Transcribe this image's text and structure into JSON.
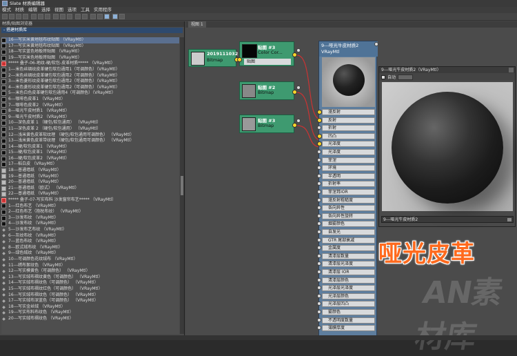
{
  "window": {
    "title": "Slate 材质编辑器"
  },
  "menu": [
    "模式",
    "材质",
    "编辑",
    "选择",
    "视图",
    "选项",
    "工具",
    "实用程序"
  ],
  "left_panel": {
    "title": "材质/贴图浏览器",
    "section": "- 搭建材质库"
  },
  "list_items": [
    {
      "text": "16---写实米黄地毯布纹贴图 （VRayMtl）",
      "sw": "black",
      "sel": true
    },
    {
      "text": "17---写实米黄地毯布纹贴图 （VRayMtl）",
      "sw": "black"
    },
    {
      "text": "18---写实蓝色地板砖贴图 （VRayMtl）",
      "sw": "black"
    },
    {
      "text": "19---写实米色地板砖贴图 （VRayMtl）",
      "sw": "black"
    },
    {
      "text": "***** 叠子-06-地纹-硬/软包-皮革材质*****    （VRayMtl）",
      "sw": "red"
    },
    {
      "text": "1---米色丝绸纹皮革硬包软包通用1（可调颜色）（VRayMtl）",
      "sw": "black"
    },
    {
      "text": "2---米色丝绸纹皮革硬包软包通用2（可调颜色）（VRayMtl）",
      "sw": "black"
    },
    {
      "text": "3---米色菱形纹皮革硬包软包通用2（可调颜色）（VRayMtl）",
      "sw": "black"
    },
    {
      "text": "4---米色菱形纹皮革硬包软包通用2（可调颜色）（VRayMtl）",
      "sw": "black"
    },
    {
      "text": "5---米色白色皮革硬包软包通用4（可调颜色）（VRayMtl）",
      "sw": "black"
    },
    {
      "text": "6---咖啡色皮革1    （VRayMtl）",
      "sw": "black"
    },
    {
      "text": "7---咖啡色皮革2    （VRayMtl）",
      "sw": "black"
    },
    {
      "text": "8---哑光牛皮材质1    （VRayMtl）",
      "sw": "black"
    },
    {
      "text": "9---哑光牛皮材质2    （VRayMtl）",
      "sw": "black"
    },
    {
      "text": "10---深色皮革 1  （硬包/软包通用）  （VRayMtl）",
      "sw": "black"
    },
    {
      "text": "11---深色皮革 2  （硬包/软包通用）  （VRayMtl）",
      "sw": "black"
    },
    {
      "text": "12---浅米黄色皮革软纹理      （硬包/软包通用可调颜色）  （VRayMtl）",
      "sw": "black"
    },
    {
      "text": "13---浅米黄色皮革带纹理      （硬包/软包通用可调颜色）  （VRayMtl）",
      "sw": "black"
    },
    {
      "text": "14---硬/软包皮革1    （VRayMtl）",
      "sw": "black"
    },
    {
      "text": "15---硬/软包皮革1    （VRayMtl）",
      "sw": "black"
    },
    {
      "text": "16---硬/软包皮革2    （VRayMtl）",
      "sw": "black"
    },
    {
      "text": "17---稻白皮    （VRayMtl）",
      "sw": "black"
    },
    {
      "text": "18---普通墙纸    （VRayMtl）",
      "sw": "gray"
    },
    {
      "text": "19---普通墙纸    （VRayMtl）",
      "sw": "gray"
    },
    {
      "text": "20---普通墙纸    （VRayMtl）",
      "sw": "gray"
    },
    {
      "text": "21---普通墙纸 （欧式）    （VRayMtl）",
      "sw": "gray"
    },
    {
      "text": "22---普通墙纸    （VRayMtl）",
      "sw": "gray"
    },
    {
      "text": "***** 叠子-07-写实布料 沙发窗帘布艺*****    （VRayMtl）",
      "sw": "red"
    },
    {
      "text": "1---红色布艺    （VRayMtl）",
      "sw": "black"
    },
    {
      "text": "2---红色布艺（抱枕布纹）    （VRayMtl）",
      "sw": "black"
    },
    {
      "text": "3---沙发布纹    （VRayMtl）",
      "sw": "black"
    },
    {
      "text": "4---沙发布纹    （VRayMtl）",
      "sw": "black"
    },
    {
      "text": "5---沙发布艺布纹    （VRayMtl）",
      "sw": "blank"
    },
    {
      "text": "6---灰纹布纹    （VRayMtl）",
      "sw": "blank"
    },
    {
      "text": "7---蓝色布纹    （VRayMtl）",
      "sw": "blank"
    },
    {
      "text": "8---欧式绒布纹    （VRayMtl）",
      "sw": "blank"
    },
    {
      "text": "9---绿色绒纹    （VRayMtl）",
      "sw": "blank"
    },
    {
      "text": "10---可调颜色花纹绒布    （VRayMtl）",
      "sw": "blank"
    },
    {
      "text": "11---绣布絮纹色 （VRayMtl）",
      "sw": "blank"
    },
    {
      "text": "12---写实模黄色（可调颜色）    （VRayMtl）",
      "sw": "blank"
    },
    {
      "text": "13---写实绒布褶纹黄色（可调颜色）    （VRayMtl）",
      "sw": "blank"
    },
    {
      "text": "14---写实绒布褶纹色（可调颜色）    （VRayMtl）",
      "sw": "blank"
    },
    {
      "text": "15---写实绒布褶纹红色（可调颜色）    （VRayMtl）",
      "sw": "blank"
    },
    {
      "text": "16---写实绒布褶纹色（可调颜色）    （VRayMtl）",
      "sw": "blank"
    },
    {
      "text": "17---写实绒布深蓝色（可调颜色）    （VRayMtl）",
      "sw": "blank"
    },
    {
      "text": "18---写实金丝绒    （VRayMtl）",
      "sw": "blank"
    },
    {
      "text": "19---写实布料布纹色    （VRayMtl）",
      "sw": "blank"
    },
    {
      "text": "20---写实绒布褶纹色    （VRayMtl）",
      "sw": "blank"
    }
  ],
  "view": {
    "tab": "视图 1"
  },
  "nodes": {
    "bmp_a": {
      "t1": "2019111032",
      "t2": "Bitmap"
    },
    "cc": {
      "t1": "贴图 #3",
      "t2": "Color Cor...",
      "port": "贴图"
    },
    "bmp2": {
      "t1": "贴图 #2",
      "t2": "Bitmap"
    },
    "bmp3": {
      "t1": "贴图 #3",
      "t2": "Bitmap"
    }
  },
  "vraymtl": {
    "name": "9---哑光牛皮材质2",
    "type": "VRayMtl",
    "slots": [
      "漫反射",
      "反射",
      "折射",
      "凹凸",
      "光泽度",
      "光泽度",
      "菲涅",
      "环境",
      "半透明",
      "折射率",
      "菲涅耳IOR",
      "漫反射粗糙度",
      "各向异性",
      "各向异性旋转",
      "烟雾颜色",
      "自发光",
      "GTR 尾部衰减",
      "金属度",
      "清漆层数量",
      "清漆层光泽度",
      "清漆层 IOR",
      "清漆层颜色",
      "光泽层光泽度",
      "光泽层颜色",
      "光泽层凹凸",
      "雾颜色",
      "不透明度数量",
      "薄膜厚度"
    ]
  },
  "preview": {
    "title": "9---哑光牛皮材质2（VRayMtl）",
    "auto_label": "自动",
    "footer": "9---哑光牛皮材质2"
  },
  "overlay_text": "哑光皮革",
  "watermark": "AN素材库",
  "watermark_small": "AN"
}
